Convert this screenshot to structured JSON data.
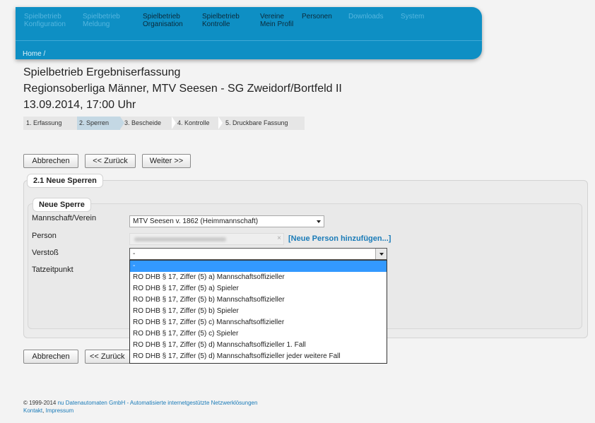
{
  "nav": {
    "items": [
      {
        "line1": "Spielbetrieb",
        "line2": "Konfiguration",
        "state": "dim"
      },
      {
        "line1": "Spielbetrieb",
        "line2": "Meldung",
        "state": "dim"
      },
      {
        "line1": "Spielbetrieb",
        "line2": "Organisation",
        "state": "active"
      },
      {
        "line1": "Spielbetrieb",
        "line2": "Kontrolle",
        "state": "active"
      },
      {
        "line1": "Vereine",
        "line2": "Mein Profil",
        "state": "active"
      },
      {
        "line1": "Personen",
        "line2": "",
        "state": "active"
      },
      {
        "line1": "Downloads",
        "line2": "",
        "state": "dim"
      },
      {
        "line1": "System",
        "line2": "",
        "state": "dim"
      }
    ],
    "breadcrumb": "Home /"
  },
  "heading": {
    "line1": "Spielbetrieb Ergebniserfassung",
    "line2": "Regionsoberliga Männer, MTV Seesen - SG Zweidorf/Bortfeld II",
    "line3": "13.09.2014, 17:00 Uhr"
  },
  "steps": [
    {
      "label": "1. Erfassung",
      "active": false
    },
    {
      "label": "2. Sperren",
      "active": true
    },
    {
      "label": "3. Bescheide",
      "active": false
    },
    {
      "label": "4. Kontrolle",
      "active": false
    },
    {
      "label": "5. Druckbare Fassung",
      "active": false
    }
  ],
  "buttons": {
    "cancel": "Abbrechen",
    "back": "<< Zurück",
    "next": "Weiter >>"
  },
  "section": {
    "outer_legend": "2.1 Neue Sperren",
    "inner_legend": "Neue Sperre"
  },
  "form": {
    "team_label": "Mannschaft/Verein",
    "team_value": "MTV Seesen v. 1862 (Heimmannschaft)",
    "person_label": "Person",
    "add_person_link": "[Neue Person hinzufügen...]",
    "violation_label": "Verstoß",
    "violation_value": "-",
    "time_label": "Tatzeitpunkt"
  },
  "dropdown_options": [
    "-",
    "RO DHB § 17, Ziffer (5) a) Mannschaftsoffizieller",
    "RO DHB § 17, Ziffer (5) a) Spieler",
    "RO DHB § 17, Ziffer (5) b) Mannschaftsoffizieller",
    "RO DHB § 17, Ziffer (5) b) Spieler",
    "RO DHB § 17, Ziffer (5) c) Mannschaftsoffizieller",
    "RO DHB § 17, Ziffer (5) c) Spieler",
    "RO DHB § 17, Ziffer (5) d) Mannschaftsoffizieller 1. Fall",
    "RO DHB § 17, Ziffer (5) d) Mannschaftsoffizieller jeder weitere Fall"
  ],
  "footer": {
    "copyright": "© 1999-2014",
    "company_link": "nu Datenautomaten GmbH - Automatisierte internetgestützte Netzwerklösungen",
    "contact_link": "Kontakt",
    "separator": ", ",
    "imprint_link": "Impressum"
  }
}
